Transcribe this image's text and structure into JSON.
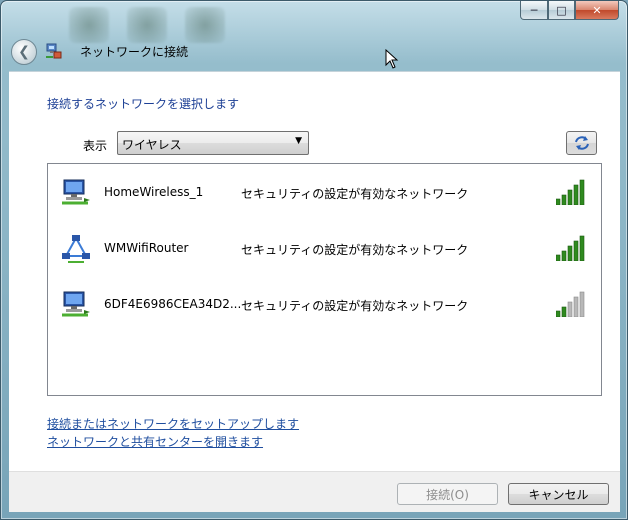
{
  "window": {
    "title": "ネットワークに接続",
    "caption_buttons": {
      "minimize": "─",
      "maximize": "□",
      "close": "✕"
    }
  },
  "heading": "接続するネットワークを選択します",
  "filter": {
    "label": "表示",
    "selected": "ワイヤレス"
  },
  "networks": [
    {
      "name": "HomeWireless_1",
      "security": "セキュリティの設定が有効なネットワーク",
      "icon": "computer-network-icon",
      "signal_bars": 5
    },
    {
      "name": "WMWifiRouter",
      "security": "セキュリティの設定が有効なネットワーク",
      "icon": "adhoc-network-icon",
      "signal_bars": 5
    },
    {
      "name": "6DF4E6986CEA34D2...",
      "security": "セキュリティの設定が有効なネットワーク",
      "icon": "computer-network-icon",
      "signal_bars": 2
    }
  ],
  "links": {
    "setup": "接続またはネットワークをセットアップします",
    "sharing_center": "ネットワークと共有センターを開きます"
  },
  "buttons": {
    "connect": "接続(O)",
    "cancel": "キャンセル"
  },
  "colors": {
    "heading": "#1c3f95",
    "link": "#1f4e9f",
    "signal_active": "#2f8a1f",
    "signal_inactive": "#b8b8b8"
  }
}
